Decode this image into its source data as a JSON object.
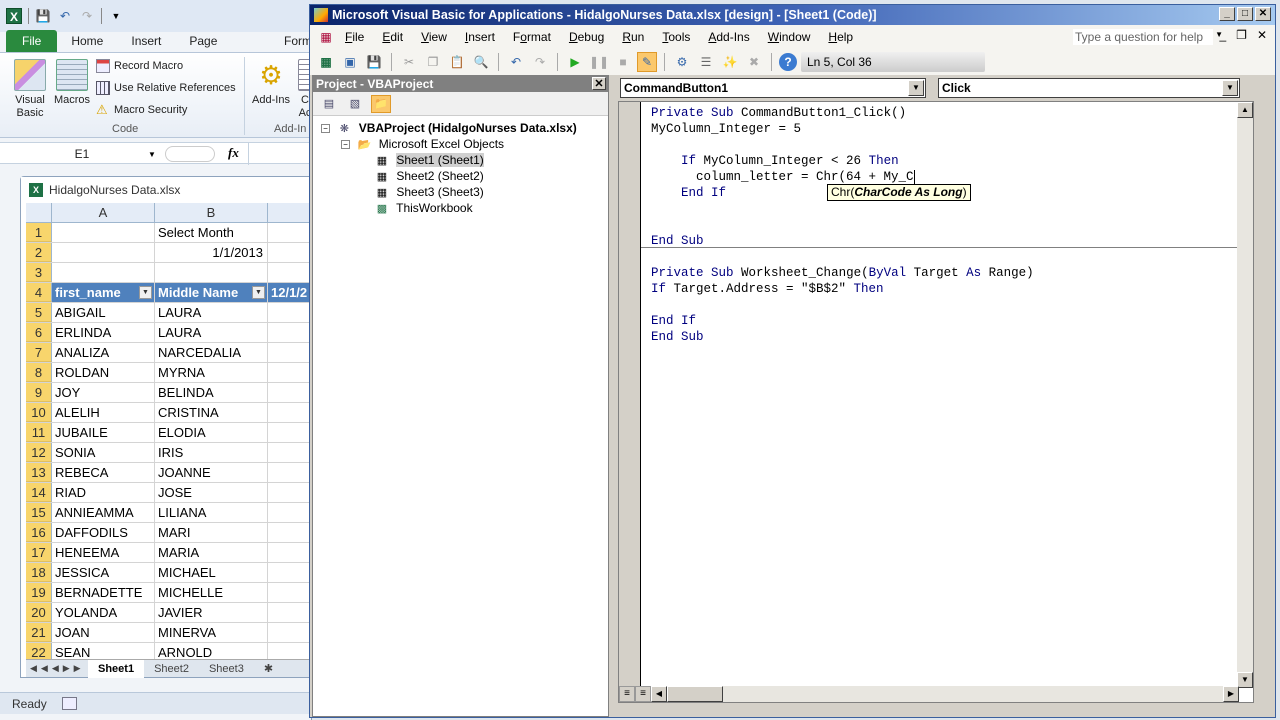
{
  "excel": {
    "qat": {
      "save_icon": "save-icon",
      "undo_icon": "undo-icon",
      "redo_icon": "redo-icon",
      "customize_icon": "customize-qat-icon"
    },
    "ribbon_tabs": [
      "File",
      "Home",
      "Insert",
      "Page Layout",
      "Form"
    ],
    "ribbon": {
      "visual_basic": "Visual Basic",
      "visual_basic_line1": "Visual",
      "visual_basic_line2": "Basic",
      "macros": "Macros",
      "record_macro": "Record Macro",
      "use_relative_references": "Use Relative References",
      "macro_security": "Macro Security",
      "code_group": "Code",
      "add_ins": "Add-Ins",
      "add_ins_group": "Add-In",
      "com_addins_partial_1": "C",
      "com_addins_partial_2": "Ac"
    },
    "name_box": "E1",
    "fx_label": "fx",
    "workbook_title": "HidalgoNurses Data.xlsx",
    "columns": [
      "A",
      "B"
    ],
    "rows": [
      {
        "n": "1",
        "a": "",
        "b": "Select Month",
        "c": ""
      },
      {
        "n": "2",
        "a": "",
        "b": "1/1/2013",
        "c": ""
      },
      {
        "n": "3",
        "a": "",
        "b": "",
        "c": ""
      },
      {
        "n": "4",
        "a": "first_name",
        "b": "Middle Name",
        "c": "12/1/2"
      },
      {
        "n": "5",
        "a": "ABIGAIL",
        "b": "LAURA",
        "c": ""
      },
      {
        "n": "6",
        "a": "ERLINDA",
        "b": "LAURA",
        "c": ""
      },
      {
        "n": "7",
        "a": "ANALIZA",
        "b": "NARCEDALIA",
        "c": ""
      },
      {
        "n": "8",
        "a": "ROLDAN",
        "b": "MYRNA",
        "c": ""
      },
      {
        "n": "9",
        "a": "JOY",
        "b": "BELINDA",
        "c": ""
      },
      {
        "n": "10",
        "a": "ALELIH",
        "b": "CRISTINA",
        "c": ""
      },
      {
        "n": "11",
        "a": "JUBAILE",
        "b": "ELODIA",
        "c": ""
      },
      {
        "n": "12",
        "a": "SONIA",
        "b": "IRIS",
        "c": ""
      },
      {
        "n": "13",
        "a": "REBECA",
        "b": "JOANNE",
        "c": ""
      },
      {
        "n": "14",
        "a": "RIAD",
        "b": "JOSE",
        "c": ""
      },
      {
        "n": "15",
        "a": "ANNIEAMMA",
        "b": "LILIANA",
        "c": ""
      },
      {
        "n": "16",
        "a": "DAFFODILS",
        "b": "MARI",
        "c": ""
      },
      {
        "n": "17",
        "a": "HENEEMA",
        "b": "MARIA",
        "c": ""
      },
      {
        "n": "18",
        "a": "JESSICA",
        "b": "MICHAEL",
        "c": ""
      },
      {
        "n": "19",
        "a": "BERNADETTE",
        "b": "MICHELLE",
        "c": ""
      },
      {
        "n": "20",
        "a": "YOLANDA",
        "b": "JAVIER",
        "c": ""
      },
      {
        "n": "21",
        "a": "JOAN",
        "b": "MINERVA",
        "c": ""
      },
      {
        "n": "22",
        "a": "SEAN",
        "b": "ARNOLD",
        "c": ""
      }
    ],
    "sheet_tabs": [
      "Sheet1",
      "Sheet2",
      "Sheet3"
    ],
    "active_sheet": "Sheet1",
    "status": "Ready",
    "colors": {
      "table_header": "#4f81bd",
      "row_header_selected": "#f8d56c",
      "file_tab": "#2a8a3e"
    }
  },
  "vbe": {
    "title": "Microsoft Visual Basic for Applications - HidalgoNurses Data.xlsx [design] - [Sheet1 (Code)]",
    "menu": [
      {
        "label": "File",
        "u": "F",
        "rest": "ile"
      },
      {
        "label": "Edit",
        "u": "E",
        "rest": "dit"
      },
      {
        "label": "View",
        "u": "V",
        "rest": "iew"
      },
      {
        "label": "Insert",
        "u": "I",
        "rest": "nsert"
      },
      {
        "label": "Format",
        "pre": "F",
        "u": "o",
        "rest": "rmat"
      },
      {
        "label": "Debug",
        "u": "D",
        "rest": "ebug"
      },
      {
        "label": "Run",
        "u": "R",
        "rest": "un"
      },
      {
        "label": "Tools",
        "u": "T",
        "rest": "ools"
      },
      {
        "label": "Add-Ins",
        "u": "A",
        "rest": "dd-Ins"
      },
      {
        "label": "Window",
        "u": "W",
        "rest": "indow"
      },
      {
        "label": "Help",
        "u": "H",
        "rest": "elp"
      }
    ],
    "help_placeholder": "Type a question for help",
    "cursor_position": "Ln 5, Col 36",
    "project_pane": {
      "title": "Project - VBAProject",
      "root": "VBAProject (HidalgoNurses Data.xlsx)",
      "folder": "Microsoft Excel Objects",
      "items": [
        "Sheet1 (Sheet1)",
        "Sheet2 (Sheet2)",
        "Sheet3 (Sheet3)",
        "ThisWorkbook"
      ],
      "selected": "Sheet1 (Sheet1)"
    },
    "object_combo": "CommandButton1",
    "procedure_combo": "Click",
    "code_lines": [
      "Private Sub CommandButton1_Click()",
      "MyColumn_Integer = 5",
      "",
      "    If MyColumn_Integer < 26 Then",
      "      column_letter = Chr(64 + My_C",
      "    End If",
      "",
      "",
      "End Sub",
      "",
      "Private Sub Worksheet_Change(ByVal Target As Range)",
      "If Target.Address = \"$B$2\" Then",
      "",
      "End If",
      "End Sub"
    ],
    "tooltip": {
      "func": "Chr(",
      "param": "CharCode As Long",
      "close": ")"
    },
    "colors": {
      "keyword": "#00007f",
      "title_start": "#0a246a",
      "title_end": "#a6caf0",
      "tooltip_bg": "#ffffe1"
    }
  }
}
